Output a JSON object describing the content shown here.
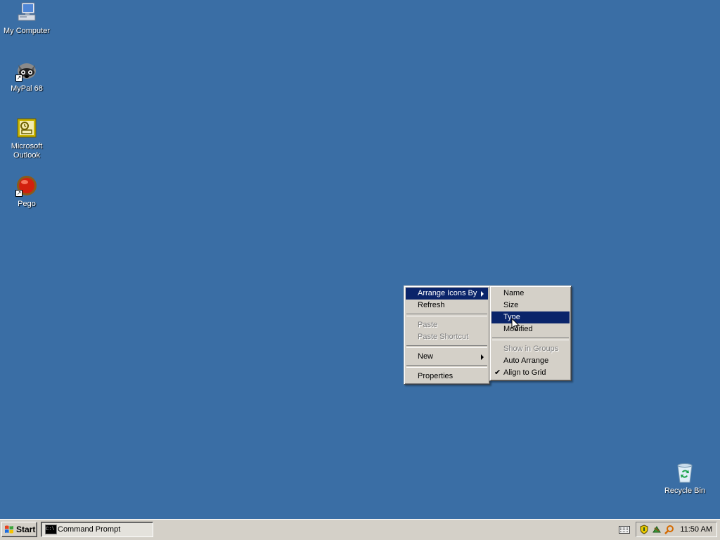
{
  "desktop": {
    "icons": [
      {
        "label": "My Computer",
        "icon": "my-computer-icon"
      },
      {
        "label": "MyPal 68",
        "icon": "mypal-icon"
      },
      {
        "label": "Microsoft\nOutlook",
        "icon": "outlook-icon"
      },
      {
        "label": "Pego",
        "icon": "pego-icon"
      },
      {
        "label": "Recycle Bin",
        "icon": "recycle-bin-icon"
      }
    ]
  },
  "context_menu": {
    "items": [
      {
        "label": "Arrange Icons By",
        "state": "highlighted",
        "submenu": true
      },
      {
        "label": "Refresh"
      },
      {
        "label": "Paste",
        "state": "disabled"
      },
      {
        "label": "Paste Shortcut",
        "state": "disabled"
      },
      {
        "label": "New",
        "submenu": true
      },
      {
        "label": "Properties"
      }
    ]
  },
  "arrange_submenu": {
    "items": [
      {
        "label": "Name"
      },
      {
        "label": "Size"
      },
      {
        "label": "Type",
        "state": "highlighted"
      },
      {
        "label": "Modified"
      },
      {
        "label": "Show in Groups",
        "state": "disabled"
      },
      {
        "label": "Auto Arrange"
      },
      {
        "label": "Align to Grid",
        "checked": true
      }
    ]
  },
  "taskbar": {
    "start_label": "Start",
    "tasks": [
      {
        "label": "Command Prompt",
        "icon": "command-prompt-icon"
      }
    ],
    "tray_icons": [
      "keyboard-icon",
      "security-shield-icon",
      "network-icon",
      "search-icon"
    ],
    "clock": "11:50 AM"
  },
  "colors": {
    "desktop_background": "#3a6ea5",
    "menu_highlight": "#0a246a",
    "menu_face": "#d4d0c8"
  }
}
